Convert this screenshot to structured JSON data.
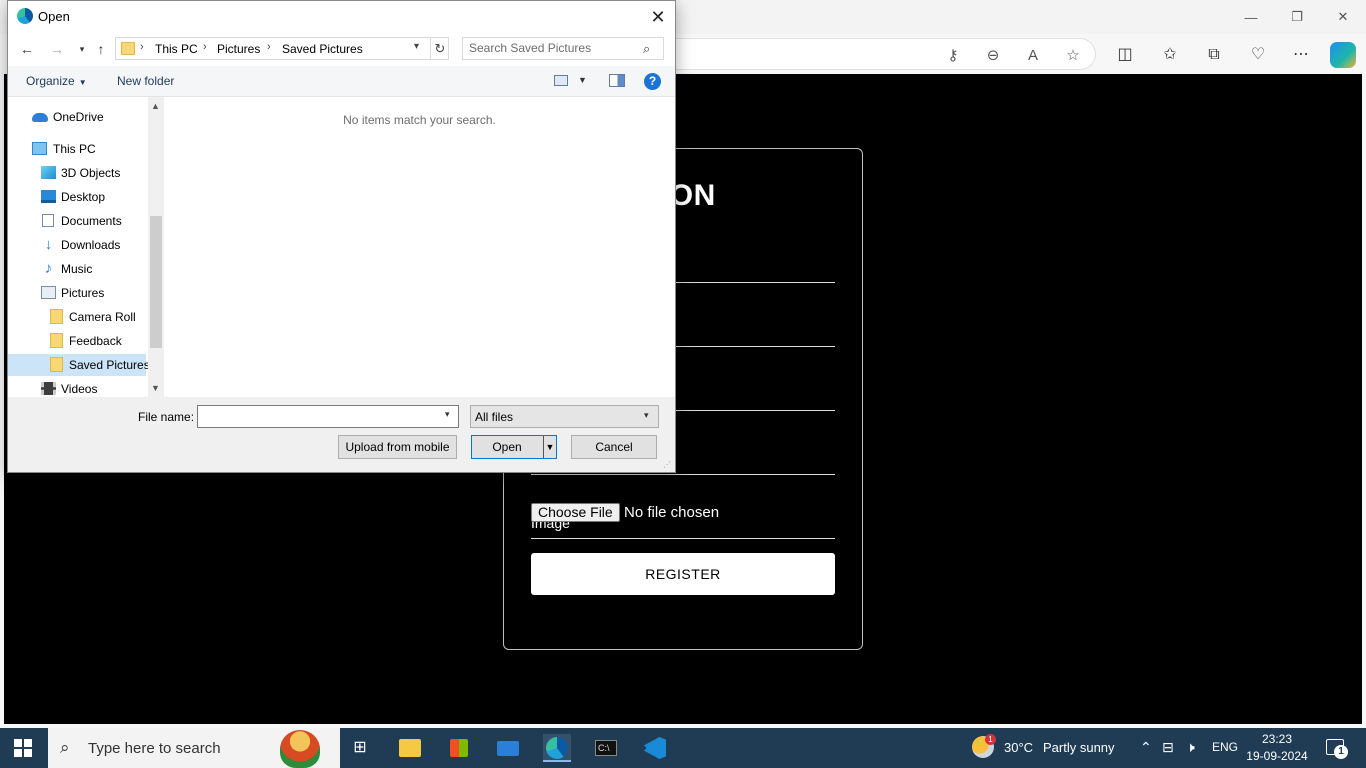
{
  "browser": {
    "window_controls": {
      "minimize": "—",
      "maximize": "❐",
      "close": "✕"
    },
    "address_icons": [
      "key-icon",
      "zoom-out-icon",
      "read-aloud-icon",
      "favorite-star-icon"
    ],
    "toolbar_icons": [
      "split-screen-icon",
      "favorites-icon",
      "collections-icon",
      "performance-icon",
      "more-icon",
      "copilot-icon"
    ]
  },
  "registration": {
    "title_visible": "RATION",
    "image_label": "Image",
    "choose_file_label": "Choose File",
    "no_file_text": "No file chosen",
    "register_label": "REGISTER"
  },
  "dialog": {
    "title": "Open",
    "breadcrumb": [
      "This PC",
      "Pictures",
      "Saved Pictures"
    ],
    "search_placeholder": "Search Saved Pictures",
    "organize_label": "Organize",
    "new_folder_label": "New folder",
    "help_label": "?",
    "empty_message": "No items match your search.",
    "tree": [
      {
        "label": "OneDrive",
        "icon": "onedrive-icon"
      },
      {
        "label": "This PC",
        "icon": "this-pc-icon"
      },
      {
        "label": "3D Objects",
        "icon": "3d-objects-icon"
      },
      {
        "label": "Desktop",
        "icon": "desktop-icon"
      },
      {
        "label": "Documents",
        "icon": "documents-icon"
      },
      {
        "label": "Downloads",
        "icon": "downloads-icon"
      },
      {
        "label": "Music",
        "icon": "music-icon"
      },
      {
        "label": "Pictures",
        "icon": "pictures-icon"
      },
      {
        "label": "Camera Roll",
        "icon": "folder-icon"
      },
      {
        "label": "Feedback",
        "icon": "folder-icon"
      },
      {
        "label": "Saved Pictures",
        "icon": "folder-icon",
        "selected": true
      },
      {
        "label": "Videos",
        "icon": "videos-icon"
      }
    ],
    "file_name_label": "File name:",
    "file_name_value": "",
    "file_type_value": "All files",
    "upload_label": "Upload from mobile",
    "open_label": "Open",
    "cancel_label": "Cancel"
  },
  "taskbar": {
    "search_placeholder": "Type here to search",
    "weather_badge": "1",
    "weather_temp": "30°C",
    "weather_text": "Partly sunny",
    "language": "ENG",
    "time": "23:23",
    "date": "19-09-2024",
    "notification_count": "1"
  }
}
